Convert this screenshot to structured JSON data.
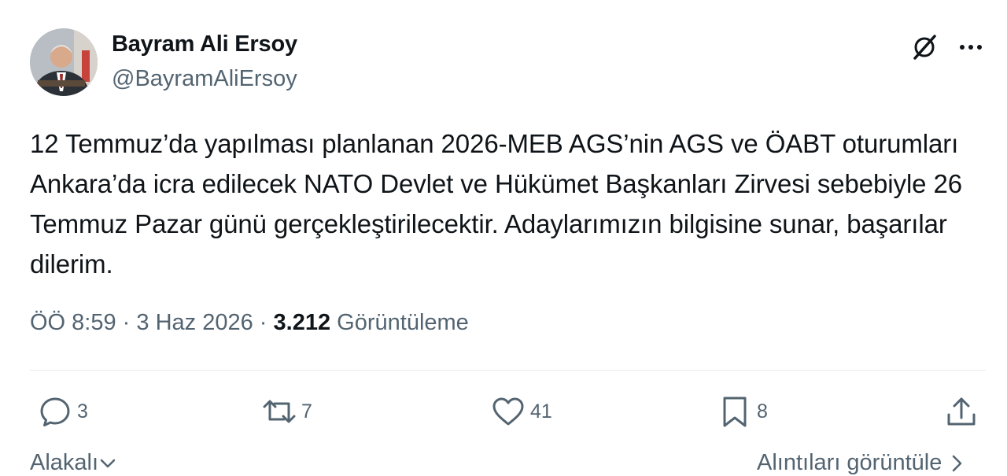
{
  "author": {
    "name": "Bayram Ali Ersoy",
    "handle": "@BayramAliErsoy"
  },
  "tweet": {
    "text": "12 Temmuz’da yapılması planlanan 2026-MEB AGS’nin AGS ve ÖABT oturumları Ankara’da icra edilecek NATO Devlet ve Hükümet Başkanları Zirvesi sebebiyle 26 Temmuz Pazar günü gerçekleştirilecektir. Adaylarımızın bilgisine sunar, başarılar dilerim.",
    "time": "ÖÖ 8:59",
    "sep1": " · ",
    "date": "3 Haz 2026",
    "sep2": " · ",
    "views": "3.212",
    "views_label": "Görüntüleme"
  },
  "actions": {
    "replies": "3",
    "reposts": "7",
    "likes": "41",
    "bookmarks": "8"
  },
  "footer": {
    "sort_label": "Alakalı",
    "quotes_label": "Alıntıları görüntüle"
  },
  "colors": {
    "text": "#0f1419",
    "secondary": "#536471",
    "divider": "#e7eaed"
  },
  "icons": [
    "grok-icon",
    "more-icon",
    "reply-icon",
    "repost-icon",
    "like-icon",
    "bookmark-icon",
    "share-icon",
    "chevron-down-icon",
    "chevron-right-icon"
  ]
}
